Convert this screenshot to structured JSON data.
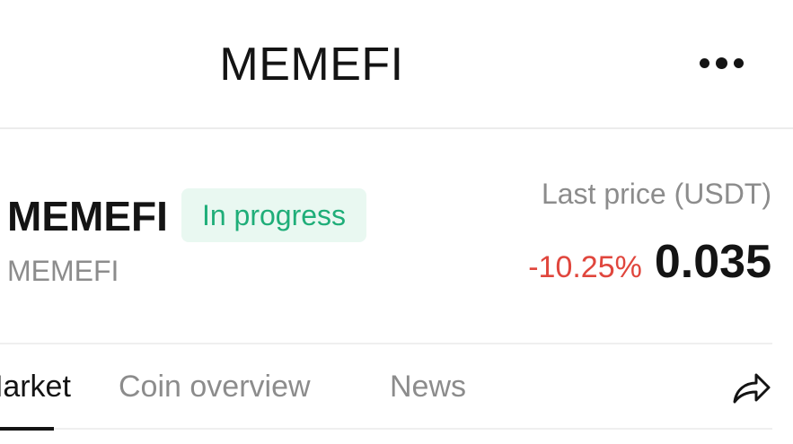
{
  "header": {
    "title": "MEMEFI",
    "more_icon": "more-dots-icon"
  },
  "coin": {
    "name": "MEMEFI",
    "status": "In progress",
    "symbol": "MEMEFI"
  },
  "price": {
    "label": "Last price (USDT)",
    "change": "-10.25%",
    "value": "0.035"
  },
  "tabs": [
    {
      "label": "Market",
      "active": true
    },
    {
      "label": "Coin overview",
      "active": false
    },
    {
      "label": "News",
      "active": false
    }
  ],
  "share_icon": "share-arrow-icon",
  "colors": {
    "status_text": "#1fae79",
    "status_bg": "#e9f8f1",
    "negative": "#e0463d",
    "muted": "#8c8c8c",
    "primary": "#141414"
  }
}
